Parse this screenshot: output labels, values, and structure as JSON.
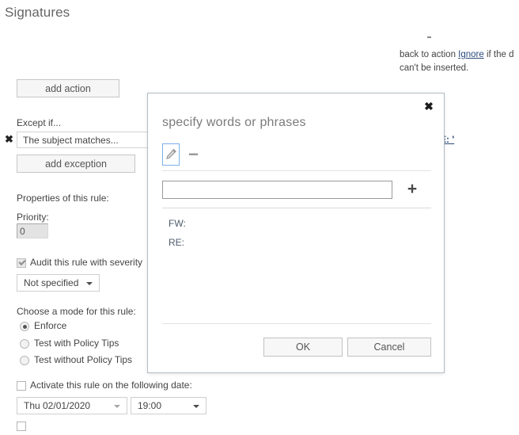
{
  "page": {
    "title": "Signatures",
    "right_note": {
      "line1_prefix": "back to action ",
      "link": "Ignore",
      "line1_suffix": " if the d",
      "line2": "can't be inserted."
    },
    "add_action_label": "add action",
    "except_if_label": "Except if...",
    "exception": {
      "remove_icon": "close-x-icon",
      "value": "The subject matches...",
      "hidden_link_text": "E: '"
    },
    "add_exception_label": "add exception",
    "properties_label": "Properties of this rule:",
    "priority_label": "Priority:",
    "priority_value": "0",
    "audit": {
      "label": "Audit this rule with severity",
      "checked": true,
      "severity_value": "Not specified"
    },
    "choose_mode_label": "Choose a mode for this rule:",
    "modes": [
      {
        "label": "Enforce",
        "selected": true
      },
      {
        "label": "Test with Policy Tips",
        "selected": false
      },
      {
        "label": "Test without Policy Tips",
        "selected": false
      }
    ],
    "activate": {
      "label": "Activate this rule on the following date:",
      "checked": false,
      "date_value": "Thu 02/01/2020",
      "time_value": "19:00"
    }
  },
  "dialog": {
    "title": "specify words or phrases",
    "close_icon": "close-icon",
    "toolbar": {
      "edit_icon": "pencil-icon",
      "remove_icon": "minus-icon"
    },
    "input": {
      "value": "",
      "placeholder": ""
    },
    "add_icon": "plus-icon",
    "items": [
      "FW:",
      "RE:"
    ],
    "ok_label": "OK",
    "cancel_label": "Cancel"
  },
  "colors": {
    "accent_blue": "#2a4b7c",
    "focus_blue": "#7ab0e8",
    "dialog_border": "#b4bcc2",
    "text": "#444444"
  }
}
